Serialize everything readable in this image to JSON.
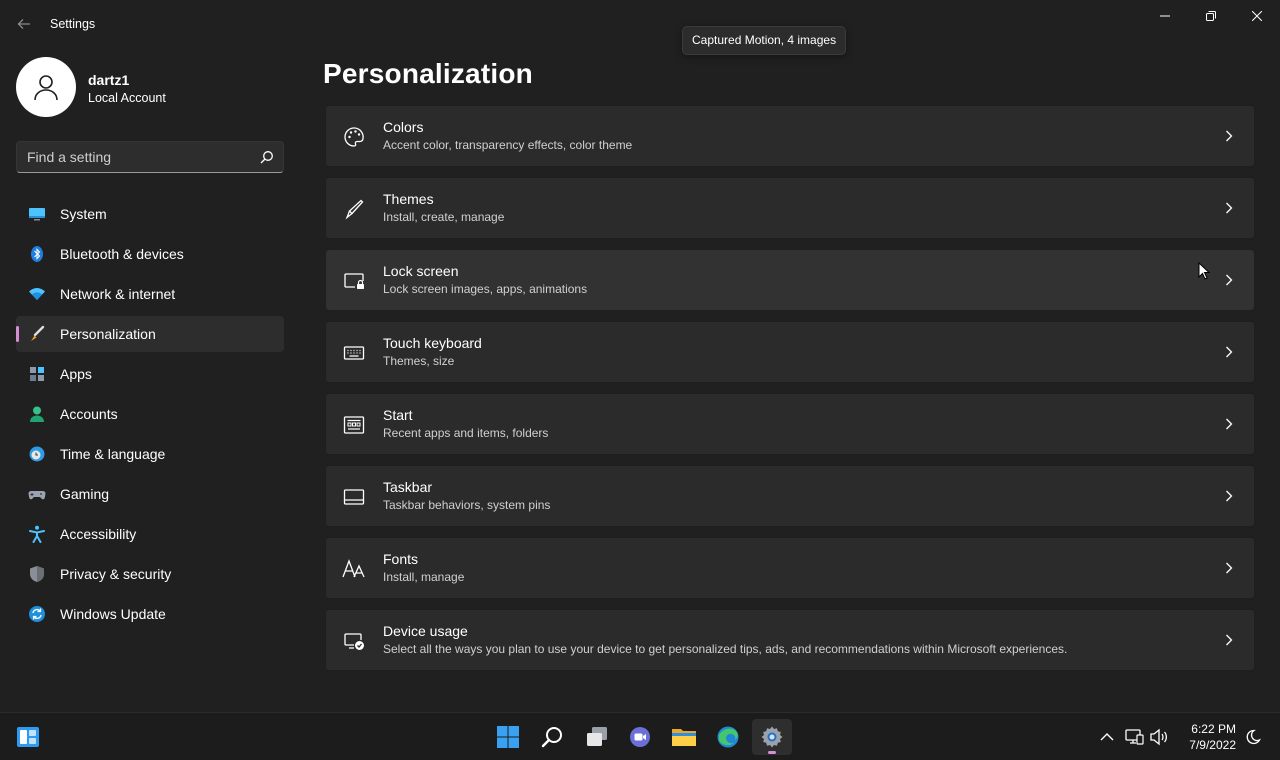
{
  "window": {
    "title": "Settings"
  },
  "tooltip": {
    "text": "Captured Motion, 4 images"
  },
  "profile": {
    "name": "dartz1",
    "account_type": "Local Account"
  },
  "search": {
    "placeholder": "Find a setting"
  },
  "sidebar": {
    "items": [
      {
        "label": "System",
        "icon": "system-icon",
        "active": false
      },
      {
        "label": "Bluetooth & devices",
        "icon": "bluetooth-icon",
        "active": false
      },
      {
        "label": "Network & internet",
        "icon": "wifi-icon",
        "active": false
      },
      {
        "label": "Personalization",
        "icon": "brush-icon",
        "active": true
      },
      {
        "label": "Apps",
        "icon": "apps-icon",
        "active": false
      },
      {
        "label": "Accounts",
        "icon": "accounts-icon",
        "active": false
      },
      {
        "label": "Time & language",
        "icon": "clock-globe-icon",
        "active": false
      },
      {
        "label": "Gaming",
        "icon": "gamepad-icon",
        "active": false
      },
      {
        "label": "Accessibility",
        "icon": "accessibility-icon",
        "active": false
      },
      {
        "label": "Privacy & security",
        "icon": "shield-icon",
        "active": false
      },
      {
        "label": "Windows Update",
        "icon": "update-icon",
        "active": false
      }
    ]
  },
  "main": {
    "title": "Personalization",
    "cards": [
      {
        "title": "Colors",
        "subtitle": "Accent color, transparency effects, color theme",
        "icon": "palette-icon"
      },
      {
        "title": "Themes",
        "subtitle": "Install, create, manage",
        "icon": "pen-icon"
      },
      {
        "title": "Lock screen",
        "subtitle": "Lock screen images, apps, animations",
        "icon": "lock-screen-icon"
      },
      {
        "title": "Touch keyboard",
        "subtitle": "Themes, size",
        "icon": "keyboard-icon"
      },
      {
        "title": "Start",
        "subtitle": "Recent apps and items, folders",
        "icon": "start-menu-icon"
      },
      {
        "title": "Taskbar",
        "subtitle": "Taskbar behaviors, system pins",
        "icon": "taskbar-icon"
      },
      {
        "title": "Fonts",
        "subtitle": "Install, manage",
        "icon": "fonts-icon"
      },
      {
        "title": "Device usage",
        "subtitle": "Select all the ways you plan to use your device to get personalized tips, ads, and recommendations within Microsoft experiences.",
        "icon": "device-usage-icon"
      }
    ]
  },
  "taskbar": {
    "apps": [
      "windows-start-icon",
      "search-icon",
      "task-view-icon",
      "chat-icon",
      "file-explorer-icon",
      "edge-icon",
      "settings-icon"
    ],
    "time": "6:22 PM",
    "date": "7/9/2022"
  },
  "colors": {
    "accent": "#d38fd4",
    "background": "#202020",
    "card": "#2b2b2b"
  }
}
